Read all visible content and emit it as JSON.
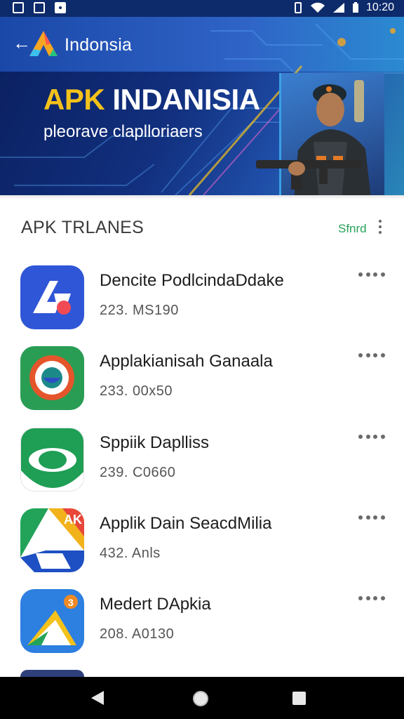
{
  "status_bar": {
    "time": "10:20"
  },
  "header": {
    "title": "Indonsia",
    "banner_title_part1": "APK",
    "banner_title_part2": "INDANISIA",
    "banner_subtitle": "pleorave claplloriaers"
  },
  "section": {
    "title": "APK TRLANES",
    "sort_label": "Sfnrd"
  },
  "apps": [
    {
      "name": "Dencite PodlcindaDdake",
      "meta": "223. MS190",
      "icon": "blue-triangle-logo-icon"
    },
    {
      "name": "Applakianisah Ganaala",
      "meta": "233. 00x50",
      "icon": "green-ring-logo-icon"
    },
    {
      "name": "Sppiik Daplliss",
      "meta": "239. C0660",
      "icon": "green-eye-logo-icon"
    },
    {
      "name": "Applik Dain SeacdMilia",
      "meta": "432. Anls",
      "icon": "multicolor-drive-logo-icon"
    },
    {
      "name": "Medert DApkia",
      "meta": "208. A0130",
      "icon": "blue-play-logo-icon"
    }
  ],
  "colors": {
    "header_bg": "#12307f",
    "banner_accent": "#f5c21b",
    "sort_green": "#27a35a"
  }
}
